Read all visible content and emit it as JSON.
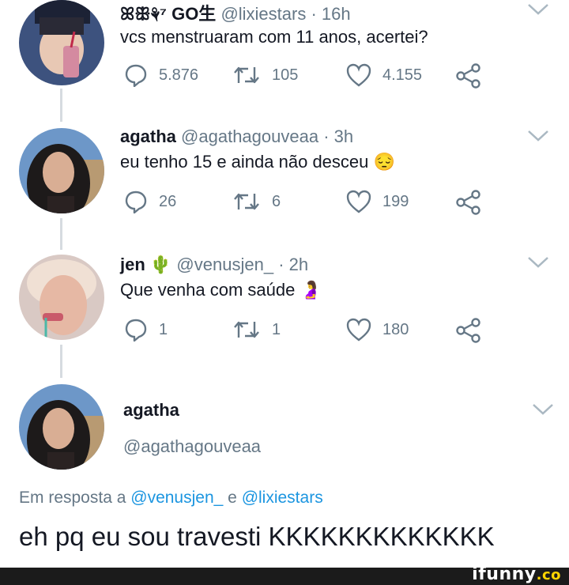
{
  "tweets": [
    {
      "name": "ꕤꕥ⚘⁷ GO生",
      "handle": "@lixiestars",
      "time": "· 16h",
      "text": "vcs menstruaram com 11 anos, acertei?",
      "replies": "5.876",
      "retweets": "105",
      "likes": "4.155",
      "avatar_color": "#3a4e7a"
    },
    {
      "name": "agatha",
      "handle": "@agathagouveaa",
      "time": "· 3h",
      "text": "eu tenho 15 e ainda não desceu 😔",
      "replies": "26",
      "retweets": "6",
      "likes": "199",
      "avatar_color": "#5b86b8"
    },
    {
      "name": "jen 🌵",
      "handle": "@venusjen_",
      "time": "· 2h",
      "text": "Que venha com saúde 🤰",
      "replies": "1",
      "retweets": "1",
      "likes": "180",
      "avatar_color": "#e8c8b8"
    }
  ],
  "focused": {
    "name": "agatha",
    "handle": "@agathagouveaa",
    "reply_prefix": "Em resposta a",
    "reply_user1": "@venusjen_",
    "reply_and": "e",
    "reply_user2": "@lixiestars",
    "text": "eh pq eu sou travesti KKKKKKKKKKKKK"
  },
  "watermark": {
    "brand": "ifunny",
    "suffix": ".co"
  },
  "colors": {
    "muted": "#657786",
    "link": "#1b95e0",
    "line": "#d6dbe0"
  }
}
